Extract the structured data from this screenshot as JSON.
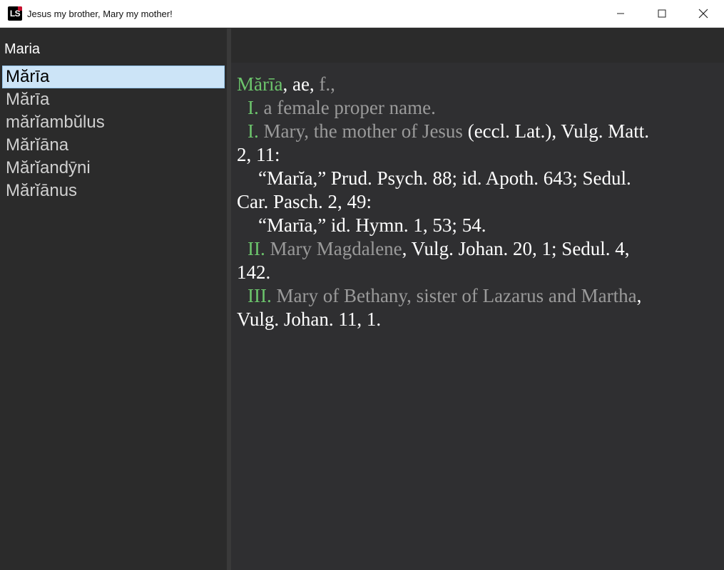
{
  "window": {
    "title": "Jesus my brother, Mary my mother!",
    "icon_text": "LS",
    "controls": [
      "minimize",
      "maximize",
      "close"
    ]
  },
  "search": {
    "value": "Maria"
  },
  "results": [
    {
      "label": "Mărīa",
      "selected": true
    },
    {
      "label": "Mărīa",
      "selected": false
    },
    {
      "label": "mărĭambŭlus",
      "selected": false
    },
    {
      "label": "Mărĭāna",
      "selected": false
    },
    {
      "label": "Mărĭandȳni",
      "selected": false
    },
    {
      "label": "Mărĭānus",
      "selected": false
    }
  ],
  "entry": {
    "headword": "Mărīa",
    "grammar_1": ", ae,",
    "grammar_2": " f.,",
    "sense_I_a_numeral": "I.",
    "sense_I_a_text": " a female proper name.",
    "sense_I_b_numeral": "I.",
    "sense_I_b_text": " Mary, the mother of Jesus",
    "sense_I_b_ref": " (eccl. Lat.), Vulg. Matt.",
    "sense_I_b_ref_cont": "2, 11:",
    "quote_1": "“Marĭa,” Prud. Psych. 88; id. Apoth. 643; Sedul.",
    "quote_1_cont": "Car. Pasch. 2, 49:",
    "quote_2": "“Marīa,” id. Hymn. 1, 53; 54.",
    "sense_II_numeral": "II.",
    "sense_II_text": " Mary Magdalene",
    "sense_II_ref": ", Vulg. Johan. 20, 1; Sedul. 4,",
    "sense_II_ref_cont": "142.",
    "sense_III_numeral": "III.",
    "sense_III_text": " Mary of Bethany, sister of Lazarus and Martha",
    "sense_III_ref": ",",
    "sense_III_ref_cont": "Vulg. Johan. 11, 1."
  },
  "colors": {
    "background": "#2f2f31",
    "headword": "#6cc46c",
    "sense_text": "#9a9a9a",
    "selection": "#cce4f7"
  }
}
